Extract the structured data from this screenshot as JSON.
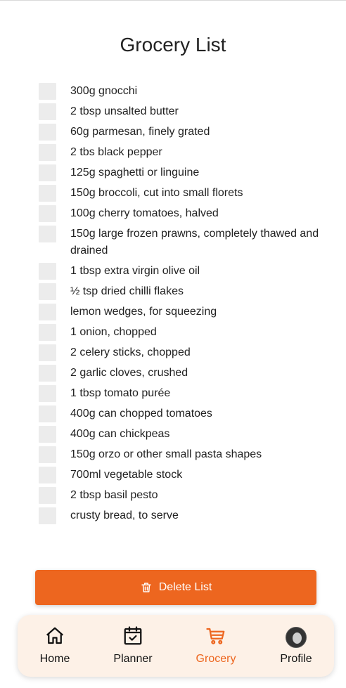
{
  "page": {
    "title": "Grocery List"
  },
  "items": [
    "300g gnocchi",
    "2 tbsp unsalted butter",
    "60g parmesan, finely grated",
    "2 tbs black pepper",
    "125g spaghetti or linguine",
    "150g broccoli, cut into small florets",
    "100g cherry tomatoes, halved",
    "150g large frozen prawns, completely thawed and drained",
    "1 tbsp extra virgin olive oil",
    "½ tsp dried chilli flakes",
    "lemon wedges, for squeezing",
    "1 onion, chopped",
    "2 celery sticks, chopped",
    "2 garlic cloves, crushed",
    "1 tbsp tomato purée",
    "400g can chopped tomatoes",
    "400g can chickpeas",
    "150g orzo or other small pasta shapes",
    "700ml vegetable stock",
    "2 tbsp basil pesto",
    "crusty bread, to serve"
  ],
  "delete_button": {
    "label": "Delete List",
    "icon": "trash-icon"
  },
  "nav": {
    "home": {
      "label": "Home",
      "icon": "home-icon"
    },
    "planner": {
      "label": "Planner",
      "icon": "calendar-check-icon"
    },
    "grocery": {
      "label": "Grocery",
      "icon": "cart-icon",
      "active": true
    },
    "profile": {
      "label": "Profile",
      "icon": "avatar"
    }
  },
  "colors": {
    "accent": "#ed661f",
    "nav_bg": "#fdf1e7",
    "checkbox": "#ececec"
  }
}
